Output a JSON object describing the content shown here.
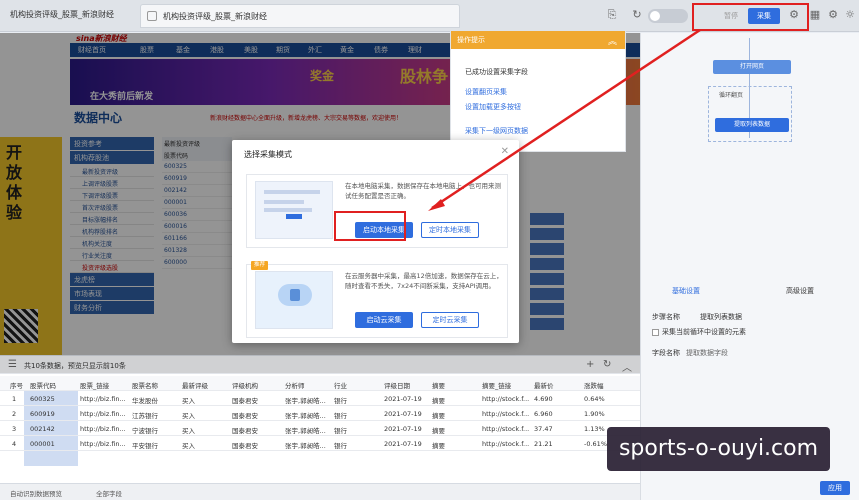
{
  "window": {
    "app_tab": "机构投资评级_股票_新浪财经",
    "doc_tab": "机构投资评级_股票_新浪财经"
  },
  "toolbar": {
    "pause_label": "暂停",
    "collect_label": "采集"
  },
  "webpage": {
    "logo": "sina新浪财经",
    "nav": [
      "财经首页",
      "股票",
      "基金",
      "港股",
      "美股",
      "期货",
      "外汇",
      "黄金",
      "债券",
      "理财",
      "银行",
      "保险",
      "银行",
      "基",
      "股票"
    ],
    "banner_left": "在大秀前后新发",
    "banner_prize": "奖金",
    "banner_brand": "股林争",
    "data_center_title": "数据中心",
    "notice": "新浪财经数据中心全面升级，新增龙虎榜、大宗交易等数据，欢迎使用！",
    "left_ad_text": "开放体验",
    "side_menu": {
      "header1": "投资参考",
      "header2": "机构荐股池",
      "items": [
        "最新投资评级",
        "上调评级股票",
        "下调评级股票",
        "首次评级股票",
        "目标涨幅排名",
        "机构荐股排名",
        "机构关注度",
        "行业关注度",
        "投资评级选股"
      ],
      "header3": "龙虎榜",
      "header4": "市场表现",
      "header5": "财务分析"
    },
    "rating_header": "最新投资评级",
    "rating_cols": [
      "股票代码",
      "股票名称"
    ],
    "rating_rows": [
      "600325",
      "600919",
      "002142",
      "000001",
      "600036",
      "600016",
      "601166",
      "601328",
      "600000"
    ]
  },
  "tips": {
    "title": "操作提示",
    "items": [
      "已成功设置采集字段",
      "设置翻页采集",
      "设置加载更多按钮",
      "采集下一级网页数据"
    ]
  },
  "flow": {
    "nodes": [
      "打开网页",
      "循环翻页",
      "提取列表数据"
    ]
  },
  "right_panel": {
    "tab1": "基础设置",
    "tab2": "高级设置",
    "step_name_label": "步骤名称",
    "step_name_value": "提取列表数据",
    "check_label": "采集当前循环中设置的元素",
    "field_label": "字段名称",
    "field_action": "提取数据字段"
  },
  "data": {
    "summary": "共10条数据，预览只显示前10条",
    "columns": [
      "序号",
      "股票代码",
      "股票_链接",
      "股票名称",
      "最新评级",
      "评级机构",
      "分析师",
      "行业",
      "评级日期",
      "摘要",
      "摘要_链接",
      "最新价",
      "涨跌幅"
    ],
    "rows": [
      [
        "1",
        "600325",
        "http://biz.fin...",
        "华发股份",
        "买入",
        "国泰君安",
        "张宇,郭昶皓...",
        "银行",
        "2021-07-19",
        "摘要",
        "http://stock.f...",
        "4.690",
        "0.64%"
      ],
      [
        "2",
        "600919",
        "http://biz.fin...",
        "江苏银行",
        "买入",
        "国泰君安",
        "张宇,郭昶皓...",
        "银行",
        "2021-07-19",
        "摘要",
        "http://stock.f...",
        "6.960",
        "1.90%"
      ],
      [
        "3",
        "002142",
        "http://biz.fin...",
        "宁波银行",
        "买入",
        "国泰君安",
        "张宇,郭昶皓...",
        "银行",
        "2021-07-19",
        "摘要",
        "http://stock.f...",
        "37.47",
        "1.13%"
      ],
      [
        "4",
        "000001",
        "http://biz.fin...",
        "平安银行",
        "买入",
        "国泰君安",
        "张宇,郭昶皓...",
        "银行",
        "2021-07-19",
        "摘要",
        "http://stock.f...",
        "21.21",
        "-0.61%"
      ]
    ]
  },
  "bottom": {
    "left1": "自动识别数据预览",
    "left2": "全部字段",
    "right_button": "应用"
  },
  "modal": {
    "title": "选择采集模式",
    "local_desc": "在本地电脑采集，数据保存在本地电脑上，也可用来测试任务配置是否正确。",
    "local_primary": "启动本地采集",
    "local_secondary": "定时本地采集",
    "cloud_tag": "推荐",
    "cloud_desc": "在云服务器中采集，最高12倍加速，数据保存在云上，随时查看不丢失，7x24不间断采集，支持API调用。",
    "cloud_primary": "启动云采集",
    "cloud_secondary": "定时云采集"
  },
  "watermark": "sports-o-ouyi.com",
  "colors": {
    "accent": "#2f6dde",
    "highlight": "#e02020",
    "tips_header": "#f0a830"
  }
}
